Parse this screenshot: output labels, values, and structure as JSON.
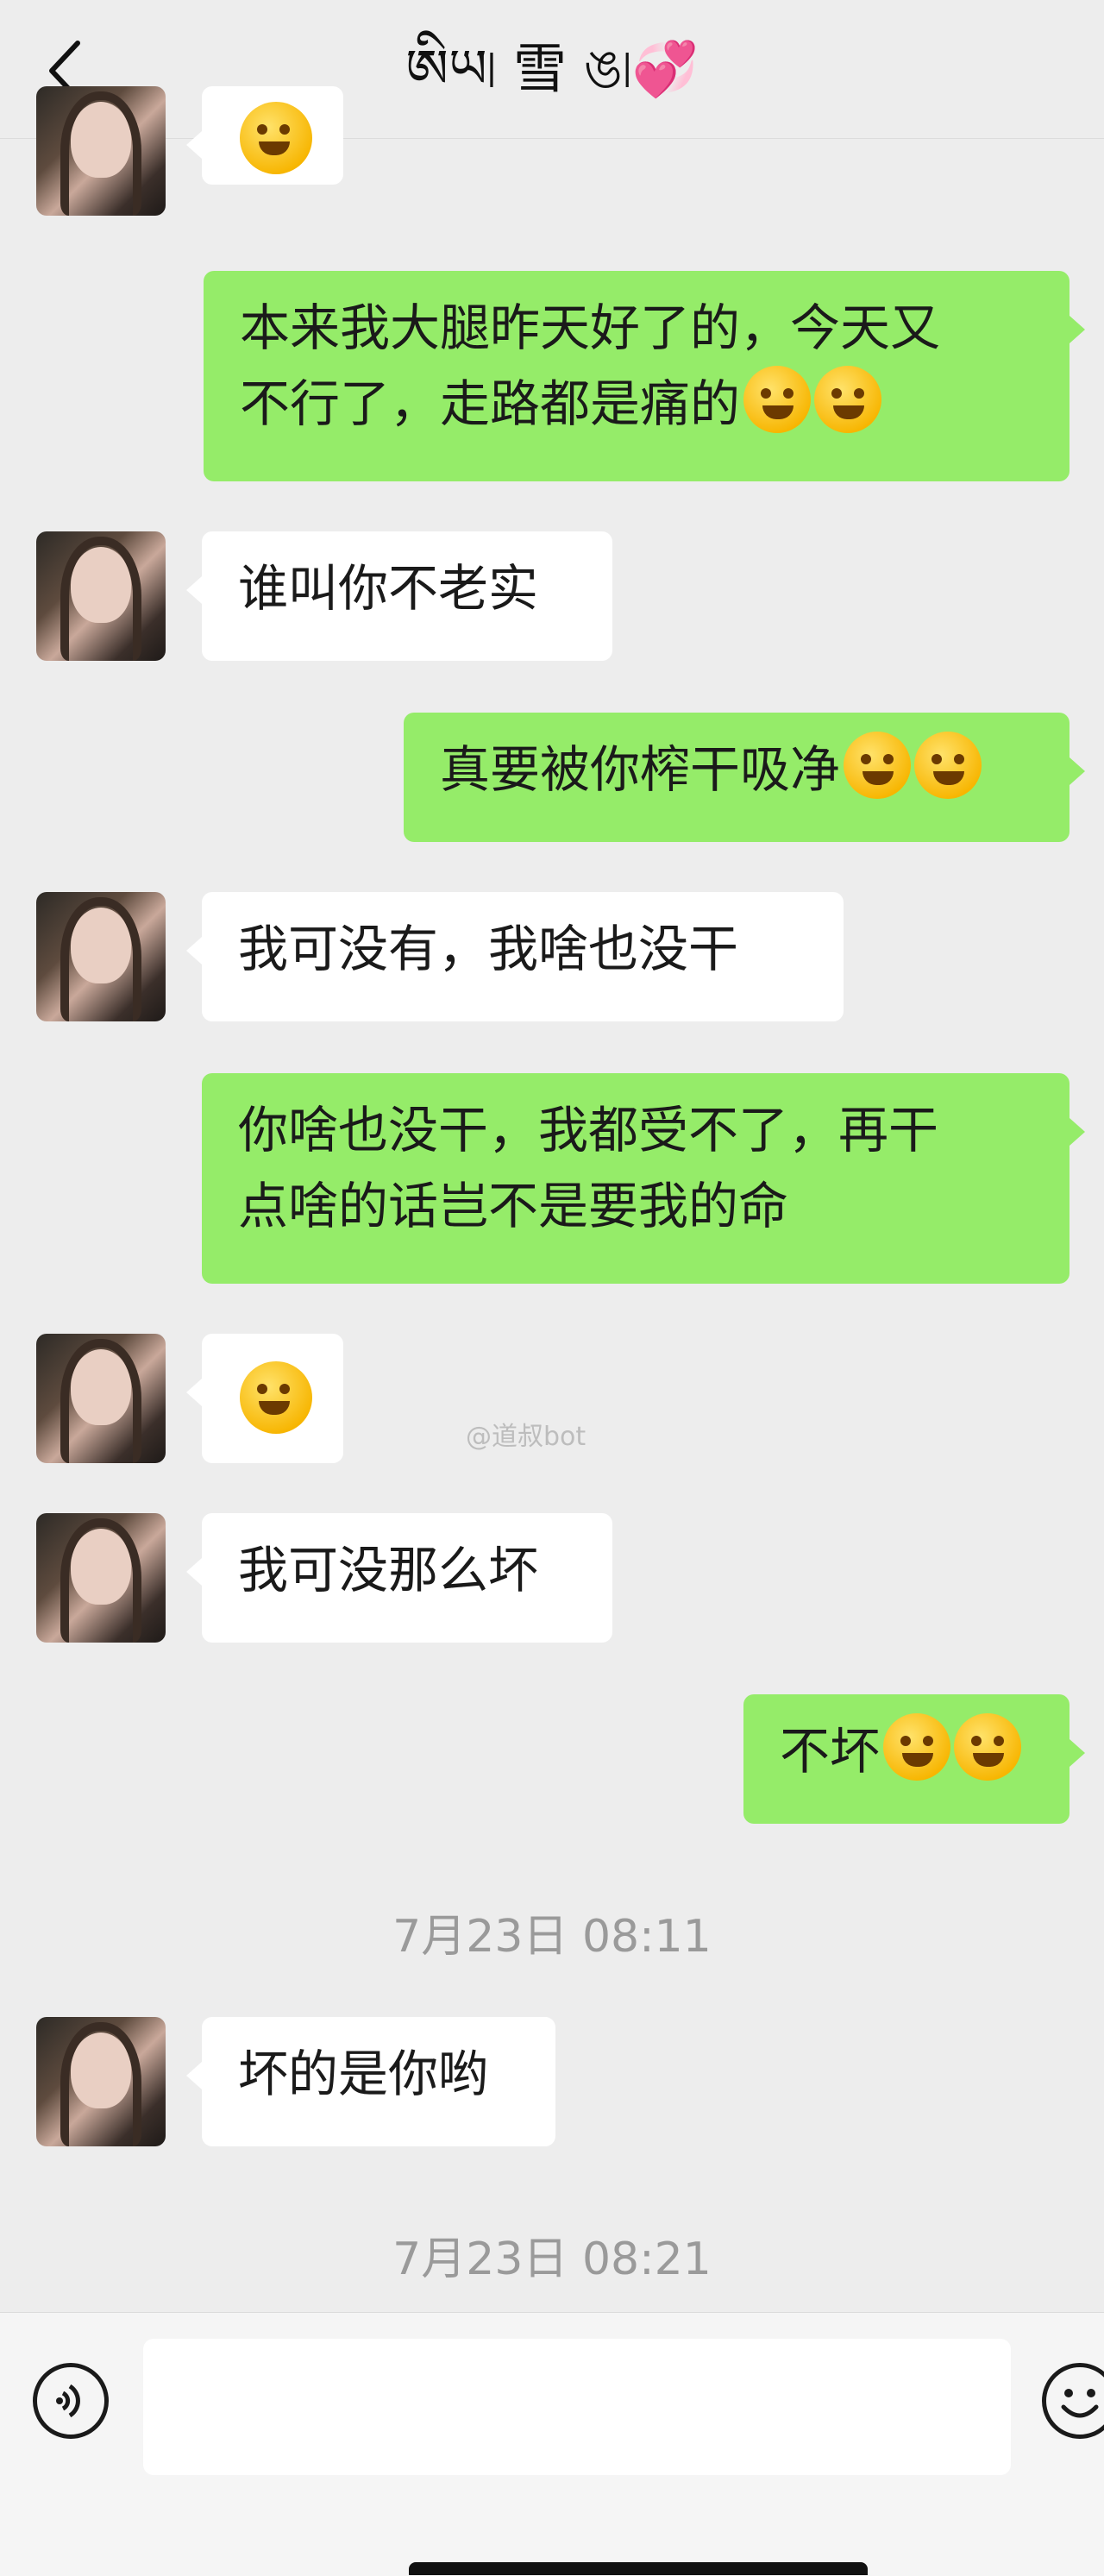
{
  "header": {
    "title": "ཨིཡ৷ 雪 ঙ৷💞"
  },
  "messages": [
    {
      "side": "in",
      "type": "emoji",
      "emoji": "laugh-cry"
    },
    {
      "side": "out",
      "lines": [
        "本来我大腿昨天好了的，今天又",
        "不行了，走路都是痛的"
      ],
      "emojis": [
        "cry",
        "cry"
      ]
    },
    {
      "side": "in",
      "lines": [
        "谁叫你不老实"
      ]
    },
    {
      "side": "out",
      "lines": [
        "真要被你榨干吸净"
      ],
      "emojis": [
        "shush",
        "shush"
      ]
    },
    {
      "side": "in",
      "lines": [
        "我可没有，我啥也没干"
      ]
    },
    {
      "side": "out",
      "lines": [
        "你啥也没干，我都受不了，再干",
        "点啥的话岂不是要我的命"
      ]
    },
    {
      "side": "in",
      "type": "emoji",
      "emoji": "laugh-cry"
    },
    {
      "side": "in",
      "lines": [
        "我可没那么坏"
      ]
    },
    {
      "side": "out",
      "lines": [
        "不坏"
      ],
      "emojis": [
        "shocked",
        "shocked"
      ]
    },
    {
      "side": "in",
      "lines": [
        "坏的是你哟"
      ]
    }
  ],
  "timestamps": [
    "7月23日 08:11",
    "7月23日 08:21"
  ],
  "watermark": "@道叔bot",
  "input": {
    "placeholder": ""
  },
  "icons": [
    "back-arrow-icon",
    "voice-icon",
    "emoji-face-icon"
  ],
  "colors": {
    "outgoing": "#95ec69",
    "incoming": "#ffffff",
    "background": "#ededed"
  }
}
